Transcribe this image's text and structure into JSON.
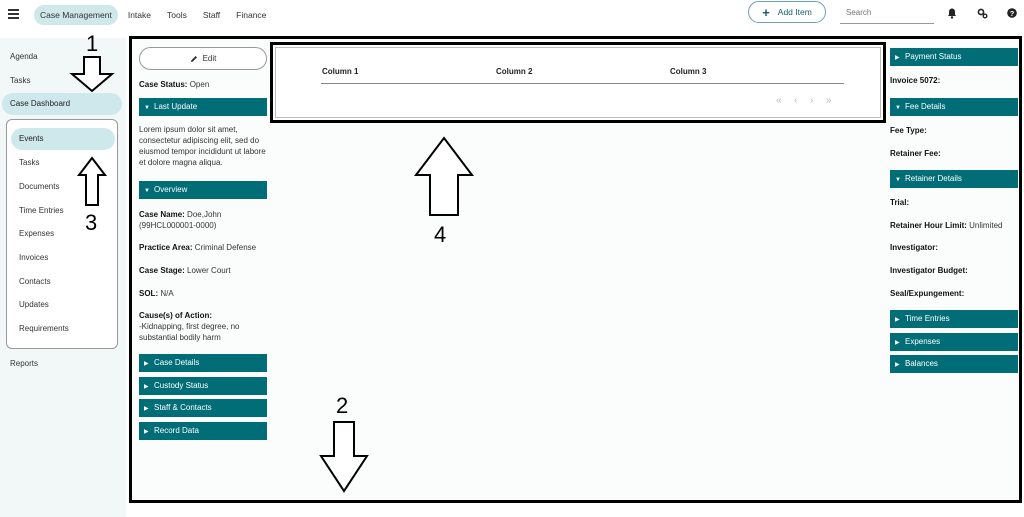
{
  "topbar": {
    "nav": [
      "Case Management",
      "Intake",
      "Tools",
      "Staff",
      "Finance"
    ],
    "add_item": "Add Item",
    "search_placeholder": "Search"
  },
  "sidebar": {
    "items": [
      "Agenda",
      "Tasks",
      "Case Dashboard",
      "Reports"
    ],
    "sub_items": [
      "Events",
      "Tasks",
      "Documents",
      "Time Entries",
      "Expenses",
      "Invoices",
      "Contacts",
      "Updates",
      "Requirements"
    ]
  },
  "annotations": [
    "1",
    "2",
    "3",
    "4"
  ],
  "left": {
    "edit": "Edit",
    "case_status_label": "Case Status:",
    "case_status_value": "Open",
    "last_update": "Last Update",
    "lorem": "Lorem ipsum dolor sit amet, consectetur adipiscing elit, sed do eiusmod tempor incididunt ut labore et dolore magna aliqua.",
    "overview": "Overview",
    "case_name_label": "Case Name:",
    "case_name_value": "Doe,John (99HCL000001-0000)",
    "practice_label": "Practice Area:",
    "practice_value": "Criminal Defense",
    "stage_label": "Case Stage:",
    "stage_value": "Lower Court",
    "sol_label": "SOL:",
    "sol_value": "N/A",
    "cause_label": "Cause(s) of Action:",
    "cause_value": "-Kidnapping, first degree, no substantial bodily harm",
    "sections": [
      "Case Details",
      "Custody Status",
      "Staff & Contacts",
      "Record Data"
    ]
  },
  "table": {
    "columns": [
      "Column 1",
      "Column 2",
      "Column 3"
    ],
    "pager": [
      "«",
      "‹",
      "›",
      "»"
    ]
  },
  "right": {
    "payment_status": "Payment Status",
    "invoice": "Invoice 5072:",
    "fee_details": "Fee Details",
    "fee_type": "Fee Type:",
    "retainer_fee": "Retainer Fee:",
    "retainer_details": "Retainer Details",
    "trial": "Trial:",
    "retainer_limit_label": "Retainer Hour Limit:",
    "retainer_limit_value": "Unlimited",
    "investigator": "Investigator:",
    "investigator_budget": "Investigator Budget:",
    "seal": "Seal/Expungement:",
    "sections": [
      "Time Entries",
      "Expenses",
      "Balances"
    ]
  }
}
